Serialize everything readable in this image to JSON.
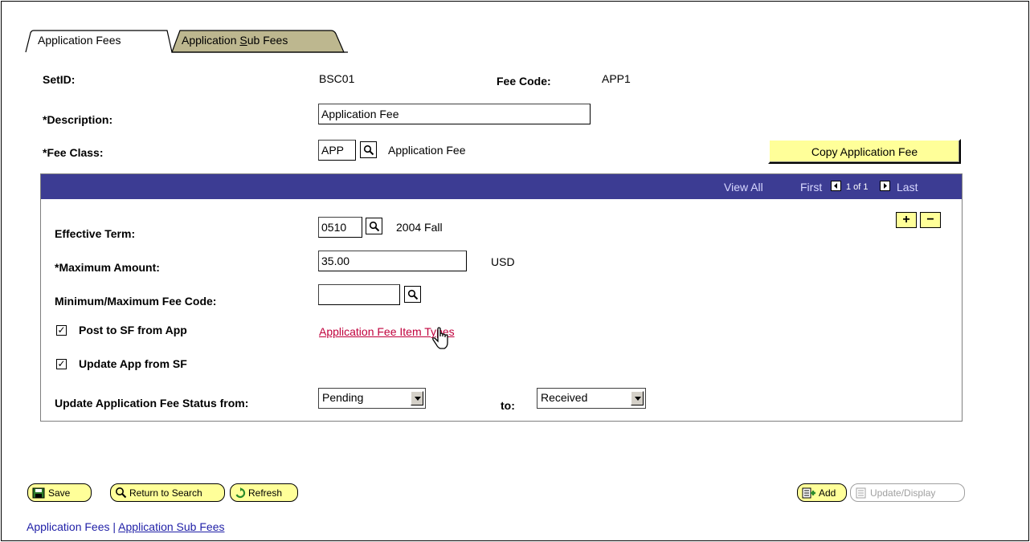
{
  "tabs": [
    {
      "label": "Application Fees",
      "active": true
    },
    {
      "label_pre": "Application ",
      "label_acc": "S",
      "label_post": "ub Fees",
      "active": false
    }
  ],
  "header": {
    "setid_label": "SetID:",
    "setid_value": "BSC01",
    "fee_code_label": "Fee Code:",
    "fee_code_value": "APP1",
    "description_label": "*Description:",
    "description_value": "Application Fee",
    "fee_class_label": "*Fee Class:",
    "fee_class_value": "APP",
    "fee_class_desc": "Application Fee",
    "copy_button": "Copy Application Fee"
  },
  "grid_nav": {
    "view_all": "View All",
    "first": "First",
    "counter": "1 of 1",
    "last": "Last"
  },
  "row": {
    "effective_term_label": "Effective Term:",
    "effective_term_value": "0510",
    "effective_term_desc": "2004 Fall",
    "max_amount_label": "*Maximum Amount:",
    "max_amount_value": "35.00",
    "currency": "USD",
    "minmax_label": "Minimum/Maximum Fee Code:",
    "minmax_value": "",
    "post_to_sf_label": "Post to SF from App",
    "post_to_sf_checked": true,
    "item_types_link": "Application Fee Item Types",
    "update_app_label": "Update App from SF",
    "update_app_checked": true,
    "status_from_label": "Update Application Fee Status from:",
    "status_from_value": "Pending",
    "to_label": "to:",
    "status_to_value": "Received"
  },
  "toolbar": {
    "save": "Save",
    "return_to_search": "Return to Search",
    "refresh": "Refresh",
    "add": "Add",
    "update_display": "Update/Display"
  },
  "footer": {
    "link1": "Application Fees",
    "separator": " | ",
    "link2": "Application Sub Fees"
  },
  "colors": {
    "nav_bar": "#3c3c93",
    "button_yellow": "#ffff99",
    "link_red": "#c0003c",
    "link_blue": "#1f1fa7"
  }
}
